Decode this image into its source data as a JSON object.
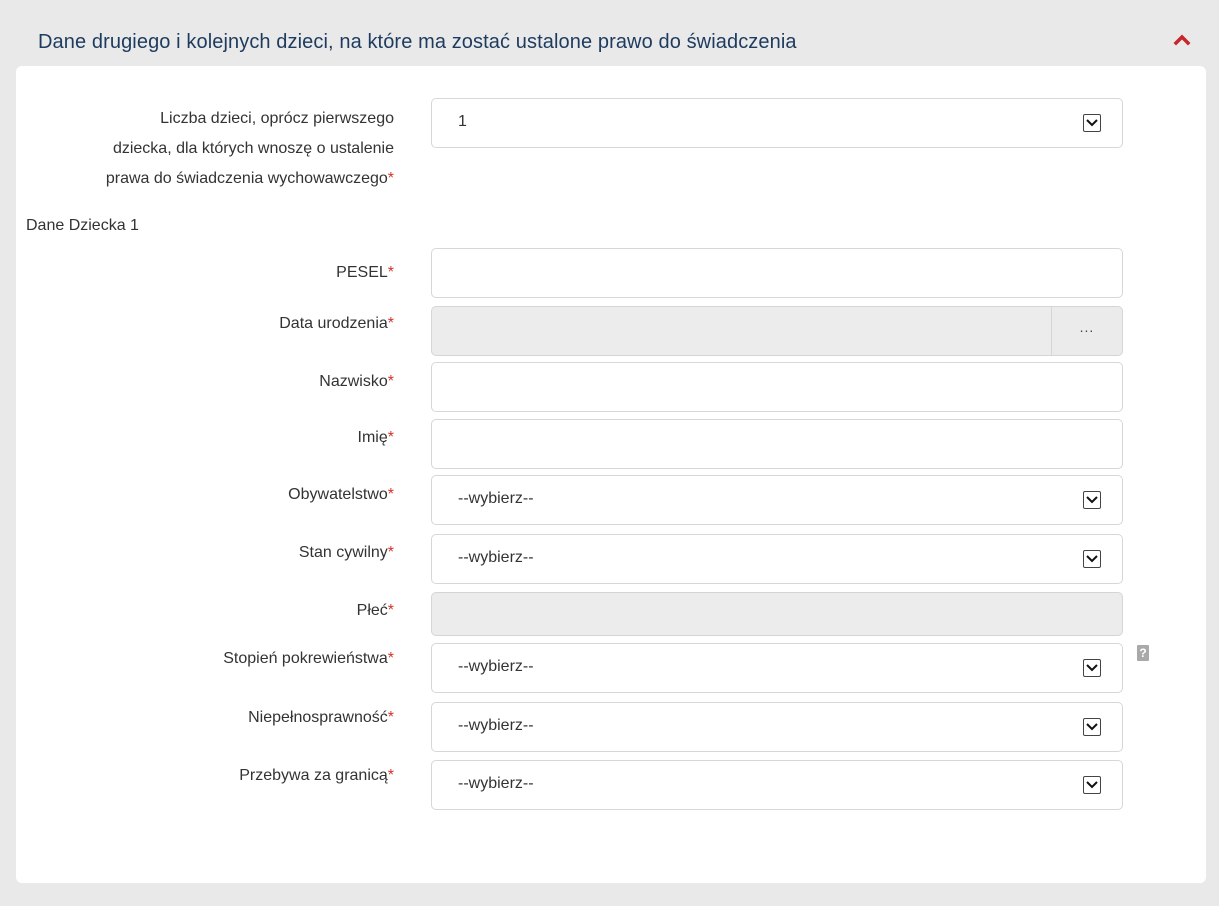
{
  "panel": {
    "title": "Dane drugiego i kolejnych dzieci, na które ma zostać ustalone prawo do świadczenia",
    "collapse_icon": "chevron-up-icon",
    "accent_color": "#c8252c",
    "title_color": "#1d3b5e"
  },
  "children_count": {
    "label_lines": [
      "Liczba dzieci, oprócz pierwszego",
      "dziecka, dla których wnoszę o ustalenie",
      "prawa do świadczenia wychowawczego"
    ],
    "required_mark": "*",
    "value": "1"
  },
  "child_section_label": "Dane Dziecka 1",
  "fields": {
    "pesel": {
      "label": "PESEL",
      "value": ""
    },
    "birth_date": {
      "label": "Data urodzenia",
      "value": "",
      "picker_label": "..."
    },
    "surname": {
      "label": "Nazwisko",
      "value": ""
    },
    "first_name": {
      "label": "Imię",
      "value": ""
    },
    "citizenship": {
      "label": "Obywatelstwo",
      "value": "--wybierz--"
    },
    "marital_status": {
      "label": "Stan cywilny",
      "value": "--wybierz--"
    },
    "sex": {
      "label": "Płeć",
      "value": ""
    },
    "kinship": {
      "label": "Stopień pokrewieństwa",
      "value": "--wybierz--"
    },
    "disability": {
      "label": "Niepełnosprawność",
      "value": "--wybierz--"
    },
    "abroad": {
      "label": "Przebywa za granicą",
      "value": "--wybierz--"
    }
  },
  "help_icon": {
    "symbol": "?"
  }
}
